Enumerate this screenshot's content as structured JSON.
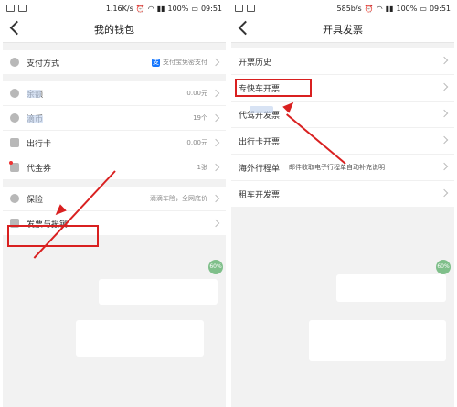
{
  "left": {
    "status": {
      "speed": "1.16K/s",
      "battery": "100%",
      "time": "09:51"
    },
    "nav_title": "我的钱包",
    "rows": [
      {
        "label": "支付方式",
        "value": "支付宝免密支付"
      },
      {
        "label": "余额",
        "value": "0.00元"
      },
      {
        "label": "滴币",
        "value": "19个"
      },
      {
        "label": "出行卡",
        "value": "0.00元"
      },
      {
        "label": "代金券",
        "value": "1张"
      },
      {
        "label": "保险",
        "value": "滴滴车险，全网底价"
      },
      {
        "label": "发票与报销",
        "value": ""
      }
    ],
    "badge": "60%"
  },
  "right": {
    "status": {
      "speed": "585b/s",
      "battery": "100%",
      "time": "09:51"
    },
    "nav_title": "开具发票",
    "rows": [
      {
        "label": "开票历史"
      },
      {
        "label": "专快车开票"
      },
      {
        "label": "代驾开发票"
      },
      {
        "label": "出行卡开票"
      },
      {
        "label": "海外行程单",
        "extra": "邮件收取电子行程单自动补充说明"
      },
      {
        "label": "租车开发票"
      }
    ],
    "badge": "60%"
  },
  "colors": {
    "accent": "#d92020",
    "alipay": "#1677ff",
    "badge": "#7fbf8a"
  }
}
